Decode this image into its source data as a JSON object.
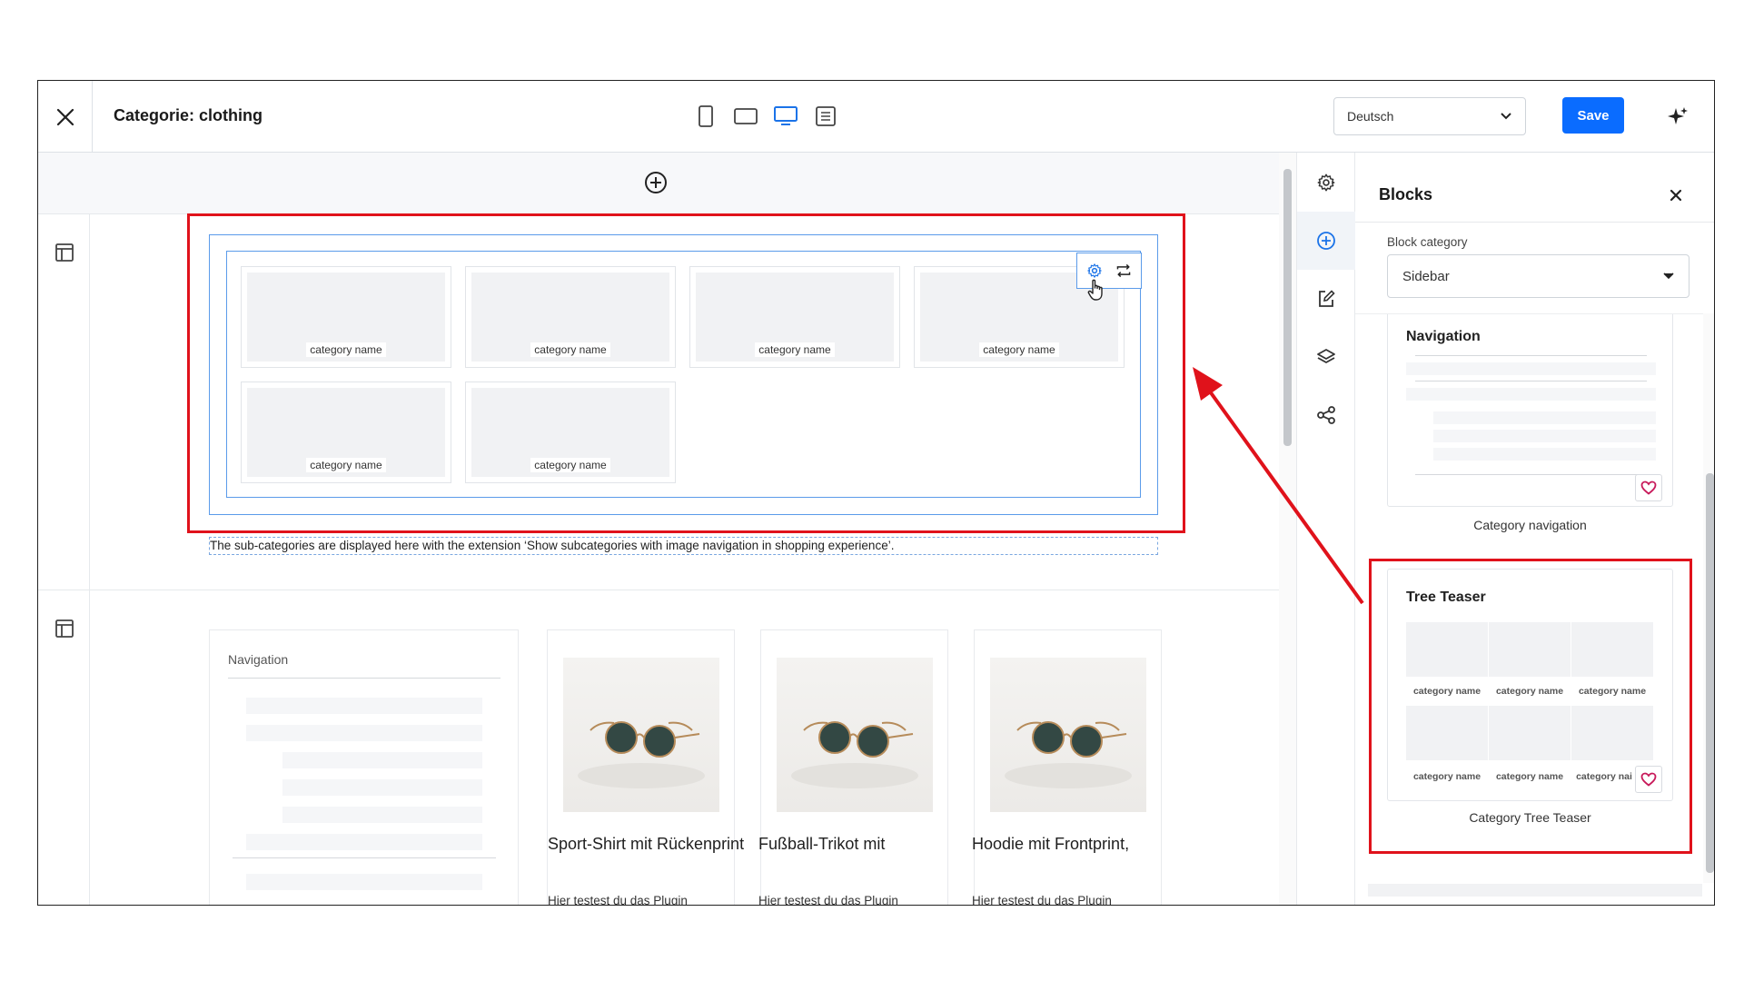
{
  "header": {
    "title": "Categorie: clothing",
    "language": "Deutsch",
    "save_label": "Save"
  },
  "canvas": {
    "tiles": [
      "category name",
      "category name",
      "category name",
      "category name",
      "category name",
      "category name"
    ],
    "note": "The sub-categories are displayed here with the extension ‘Show subcategories with image navigation in shopping experience’.",
    "nav_card_title": "Navigation",
    "products": [
      {
        "name": "Sport-Shirt mit Rückenprint",
        "desc": "Hier testest du das Plugin"
      },
      {
        "name": "Fußball-Trikot mit Rückenprint",
        "desc": "Hier testest du das Plugin"
      },
      {
        "name": "Hoodie mit Frontprint, personalisierbar",
        "desc": "Hier testest du das Plugin"
      }
    ]
  },
  "panel": {
    "title": "Blocks",
    "category_label": "Block category",
    "category_value": "Sidebar",
    "blocks": [
      {
        "title": "Navigation",
        "caption": "Category navigation"
      },
      {
        "title": "Tree Teaser",
        "caption": "Category Tree Teaser",
        "labels": [
          "category name",
          "category name",
          "category name",
          "category name",
          "category name",
          "category nai"
        ]
      }
    ]
  },
  "colors": {
    "accent": "#0a6cff",
    "selection": "#5b9bea",
    "annotation": "#e0121b",
    "favorite": "#c8195a"
  },
  "icons": [
    "close-icon",
    "mobile-icon",
    "tablet-icon",
    "desktop-icon",
    "list-view-icon",
    "chevron-down-icon",
    "sparkle-icon",
    "add-circle-icon",
    "layout-icon",
    "gear-icon",
    "swap-icon",
    "hand-cursor-icon",
    "edit-icon",
    "layers-icon",
    "share-icon",
    "heart-icon"
  ]
}
